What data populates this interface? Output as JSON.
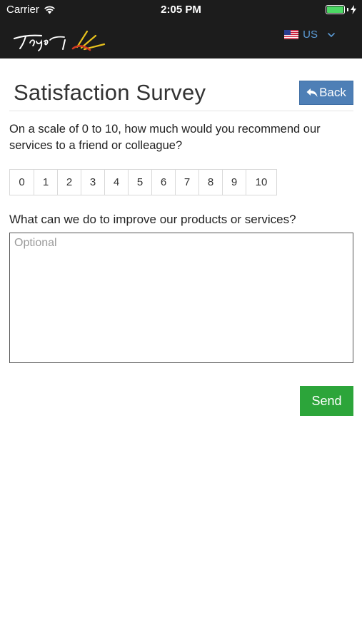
{
  "status_bar": {
    "carrier": "Carrier",
    "time": "2:05 PM"
  },
  "nav": {
    "language": "US",
    "accent_color": "#5b9bd5"
  },
  "page": {
    "title": "Satisfaction Survey",
    "back_label": "Back"
  },
  "survey": {
    "question_1": "On a scale of 0 to 10, how much would you recommend our services to a friend or colleague?",
    "scale_options": [
      "0",
      "1",
      "2",
      "3",
      "4",
      "5",
      "6",
      "7",
      "8",
      "9",
      "10"
    ],
    "question_2": "What can we do to improve our products or services?",
    "feedback_placeholder": "Optional",
    "feedback_value": "",
    "send_label": "Send"
  },
  "colors": {
    "back_button": "#4e7fb6",
    "send_button": "#2ca53a",
    "header_bg": "#1c1c1c"
  }
}
